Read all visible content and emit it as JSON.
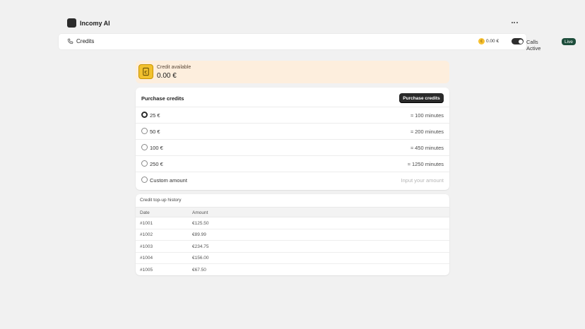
{
  "app": {
    "title": "Incomy AI"
  },
  "header": {
    "page_title": "Credits",
    "balance": "0.00 €",
    "calls_label": "Calls Active",
    "live_badge": "Live"
  },
  "credit": {
    "label": "Credit available",
    "value": "0.00 €"
  },
  "purchase": {
    "title": "Purchase credits",
    "button_label": "Purchase credits",
    "options": [
      {
        "label": "25 €",
        "minutes": "≈ 100 minutes",
        "selected": true
      },
      {
        "label": "50 €",
        "minutes": "≈ 200 minutes",
        "selected": false
      },
      {
        "label": "100 €",
        "minutes": "≈ 450 minutes",
        "selected": false
      },
      {
        "label": "250 €",
        "minutes": "≈ 1250 minutes",
        "selected": false
      }
    ],
    "custom": {
      "label": "Custom amount",
      "placeholder": "Input your amount"
    }
  },
  "history": {
    "title": "Credit top-up history",
    "columns": [
      "Date",
      "Amount"
    ],
    "rows": [
      {
        "date": "#1001",
        "amount": "€125.50"
      },
      {
        "date": "#1002",
        "amount": "€89.99"
      },
      {
        "date": "#1003",
        "amount": "€234.75"
      },
      {
        "date": "#1004",
        "amount": "€156.00"
      },
      {
        "date": "#1005",
        "amount": "€67.50"
      }
    ]
  },
  "colors": {
    "accent_dark": "#2a2a2a",
    "live_badge": "#1d4d3b",
    "banner_bg": "#fdeedd",
    "coin": "#f6c030"
  },
  "icons": [
    "app-logo",
    "more-icon",
    "phone-icon",
    "coin-icon",
    "credit-card-icon"
  ]
}
